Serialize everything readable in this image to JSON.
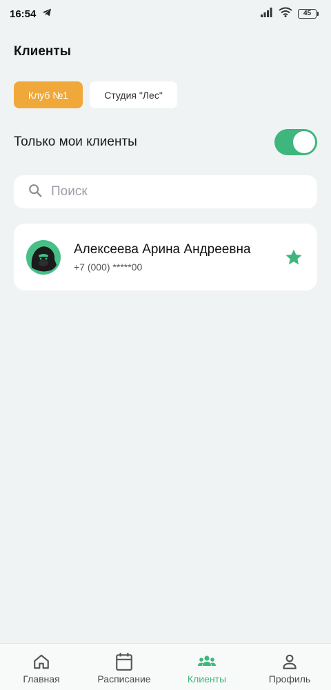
{
  "status_bar": {
    "time": "16:54",
    "battery": "45",
    "icons": [
      "telegram-icon",
      "signal-icon",
      "wifi-icon",
      "battery-icon"
    ]
  },
  "page": {
    "title": "Клиенты"
  },
  "clubs": [
    {
      "label": "Клуб №1",
      "selected": true
    },
    {
      "label": "Студия \"Лес\"",
      "selected": false
    }
  ],
  "filter": {
    "label": "Только мои клиенты",
    "enabled": true
  },
  "search": {
    "placeholder": "Поиск",
    "value": ""
  },
  "clients": [
    {
      "name": "Алексеева Арина Андреевна",
      "phone": "+7 (000) *****00",
      "favorite": true
    }
  ],
  "nav": [
    {
      "label": "Главная",
      "icon": "home-icon",
      "active": false
    },
    {
      "label": "Расписание",
      "icon": "calendar-icon",
      "active": false
    },
    {
      "label": "Клиенты",
      "icon": "users-icon",
      "active": true
    },
    {
      "label": "Профиль",
      "icon": "profile-icon",
      "active": false
    }
  ],
  "colors": {
    "accent_green": "#3fb67d",
    "accent_orange": "#f0a83b",
    "background": "#eff3f4"
  }
}
